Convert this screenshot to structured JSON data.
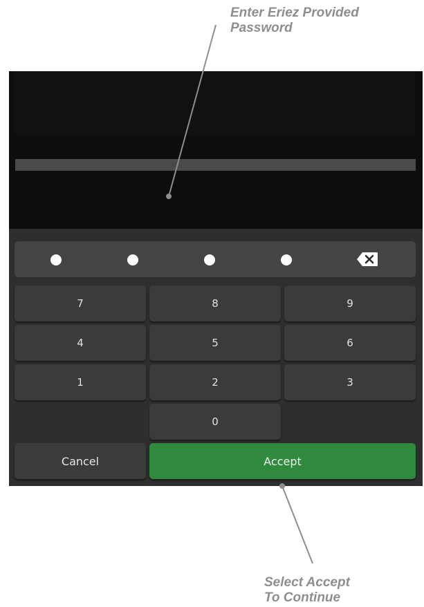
{
  "callouts": {
    "password_line1": "Enter Eriez Provided",
    "password_line2": "Password",
    "accept_line1": "Select Accept",
    "accept_line2": "To Continue"
  },
  "pin": {
    "entered_digits": 4,
    "mask_char": "●",
    "backspace_icon": "backspace-icon"
  },
  "keypad": {
    "keys": {
      "k7": "7",
      "k8": "8",
      "k9": "9",
      "k4": "4",
      "k5": "5",
      "k6": "6",
      "k1": "1",
      "k2": "2",
      "k3": "3",
      "k0": "0"
    },
    "cancel_label": "Cancel",
    "accept_label": "Accept"
  },
  "colors": {
    "accept_green": "#2f8a3e",
    "key_gray": "#3b3b3b",
    "keypad_bg": "#2e2e2e",
    "callout_gray": "#8e8e8e"
  }
}
